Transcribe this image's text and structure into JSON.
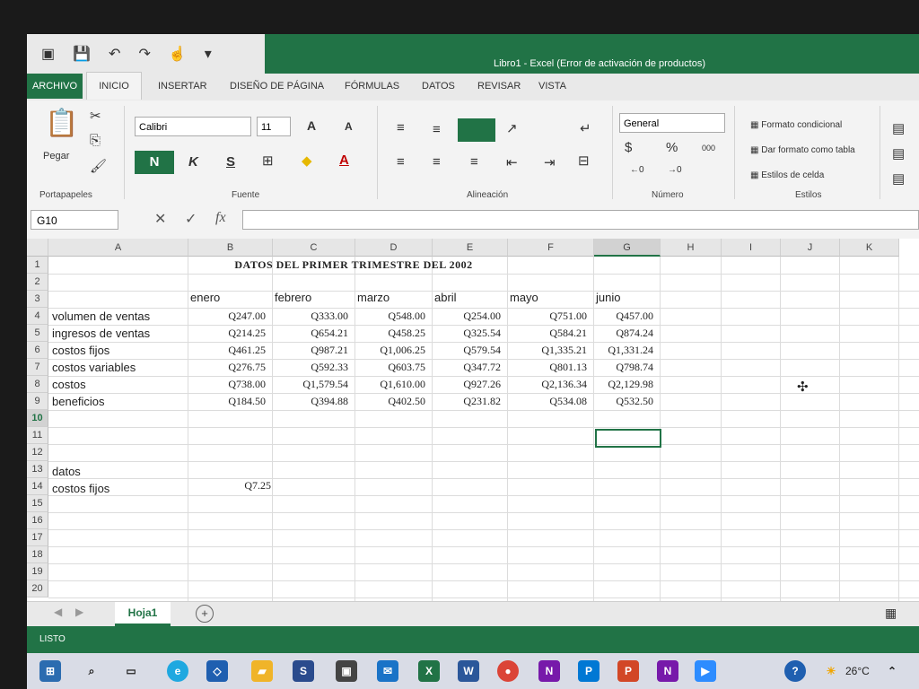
{
  "window": {
    "title": "Libro1 - Excel (Error de activación de productos)"
  },
  "ribbon": {
    "tabs": [
      "ARCHIVO",
      "INICIO",
      "INSERTAR",
      "DISEÑO DE PÁGINA",
      "FÓRMULAS",
      "DATOS",
      "REVISAR",
      "VISTA"
    ],
    "paste_label": "Pegar",
    "font_name": "Calibri",
    "font_size": "11",
    "bold_label": "N",
    "italic_label": "K",
    "underline_label": "S",
    "number_format": "General",
    "percent_label": "%",
    "thousands_label": "000",
    "styles": [
      "Formato condicional",
      "Dar formato como tabla",
      "Estilos de celda"
    ],
    "groups": [
      "Portapapeles",
      "Fuente",
      "Alineación",
      "Número",
      "Estilos"
    ]
  },
  "formula_bar": {
    "name_box": "G10",
    "fx": "fx",
    "value": ""
  },
  "sheet": {
    "columns": [
      "A",
      "B",
      "C",
      "D",
      "E",
      "F",
      "G",
      "H",
      "I",
      "J",
      "K"
    ],
    "rows": [
      "1",
      "2",
      "3",
      "4",
      "5",
      "6",
      "7",
      "8",
      "9",
      "10",
      "11",
      "12",
      "13",
      "14",
      "15",
      "16",
      "17",
      "18",
      "19",
      "20"
    ],
    "title": "DATOS DEL PRIMER TRIMESTRE DEL 2002",
    "months": [
      "enero",
      "febrero",
      "marzo",
      "abril",
      "mayo",
      "junio"
    ],
    "data_rows": [
      {
        "label": "volumen de ventas",
        "values": [
          "Q247.00",
          "Q333.00",
          "Q548.00",
          "Q254.00",
          "Q751.00",
          "Q457.00"
        ]
      },
      {
        "label": "ingresos de ventas",
        "values": [
          "Q214.25",
          "Q654.21",
          "Q458.25",
          "Q325.54",
          "Q584.21",
          "Q874.24"
        ]
      },
      {
        "label": "costos fijos",
        "values": [
          "Q461.25",
          "Q987.21",
          "Q1,006.25",
          "Q579.54",
          "Q1,335.21",
          "Q1,331.24"
        ]
      },
      {
        "label": "costos variables",
        "values": [
          "Q276.75",
          "Q592.33",
          "Q603.75",
          "Q347.72",
          "Q801.13",
          "Q798.74"
        ]
      },
      {
        "label": "costos",
        "values": [
          "Q738.00",
          "Q1,579.54",
          "Q1,610.00",
          "Q927.26",
          "Q2,136.34",
          "Q2,129.98"
        ]
      },
      {
        "label": "beneficios",
        "values": [
          "Q184.50",
          "Q394.88",
          "Q402.50",
          "Q231.82",
          "Q534.08",
          "Q532.50"
        ]
      }
    ],
    "datos_label": "datos",
    "costos_fijos_label": "costos fijos",
    "costos_fijos_value": "Q7.25",
    "selected_cell": "G10"
  },
  "sheet_tabs": {
    "active": "Hoja1",
    "add": "+"
  },
  "status": {
    "text": "LISTO"
  },
  "taskbar": {
    "temperature": "26°C"
  }
}
